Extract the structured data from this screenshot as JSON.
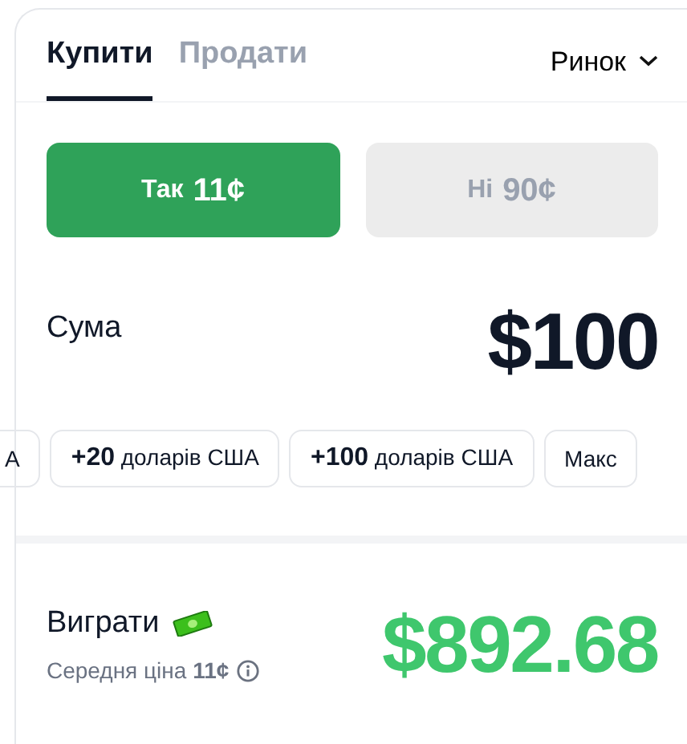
{
  "tabs": [
    {
      "label": "Купити",
      "selected": true
    },
    {
      "label": "Продати",
      "selected": false
    }
  ],
  "order_type": "Ринок",
  "outcomes": [
    {
      "label": "Так",
      "price": "11¢",
      "selected": true
    },
    {
      "label": "Ні",
      "price": "90¢",
      "selected": false
    }
  ],
  "amount": {
    "label": "Сума",
    "value": "$100"
  },
  "quick_amounts": [
    "А",
    "**+20** доларів США",
    "**+100** доларів США",
    "Макс"
  ],
  "payout": {
    "label": "Виграти",
    "average_price": "Середня ціна **11¢**",
    "value": "$892.68"
  }
}
